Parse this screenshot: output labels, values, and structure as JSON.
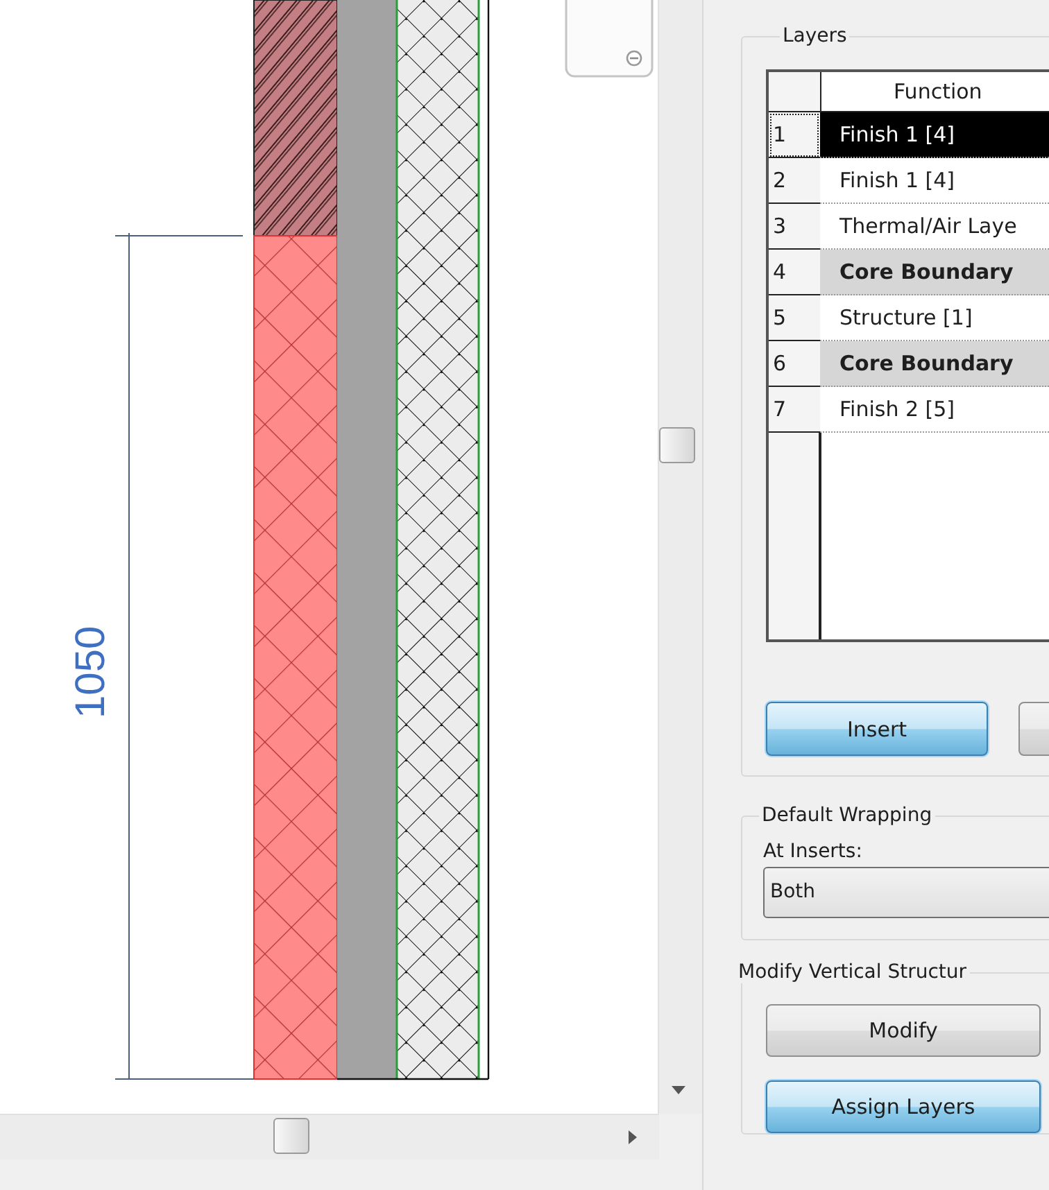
{
  "canvas": {
    "dimension": "1050"
  },
  "layers": {
    "title": "Layers",
    "columns": [
      "Function"
    ],
    "rows": [
      {
        "number": "1",
        "function": "Finish 1 [4]",
        "kind": "layer",
        "selected": true
      },
      {
        "number": "2",
        "function": "Finish 1 [4]",
        "kind": "layer",
        "selected": false
      },
      {
        "number": "3",
        "function": "Thermal/Air Laye",
        "kind": "layer",
        "selected": false
      },
      {
        "number": "4",
        "function": "Core Boundary",
        "kind": "boundary",
        "selected": false
      },
      {
        "number": "5",
        "function": "Structure [1]",
        "kind": "layer",
        "selected": false
      },
      {
        "number": "6",
        "function": "Core Boundary",
        "kind": "boundary",
        "selected": false
      },
      {
        "number": "7",
        "function": "Finish 2 [5]",
        "kind": "layer",
        "selected": false
      }
    ],
    "buttons": [
      {
        "label": "Insert",
        "kind": "highlighted"
      },
      {
        "kind": "plain"
      }
    ]
  },
  "default_wrapping": {
    "title": "Default Wrapping",
    "label": "At Inserts:",
    "value": "Both"
  },
  "modify_vertical_structure": {
    "title": "Modify Vertical Structur",
    "buttons": [
      {
        "label": "Modify",
        "kind": "plain"
      },
      {
        "label": "Assign Layers",
        "kind": "highlighted"
      }
    ]
  }
}
